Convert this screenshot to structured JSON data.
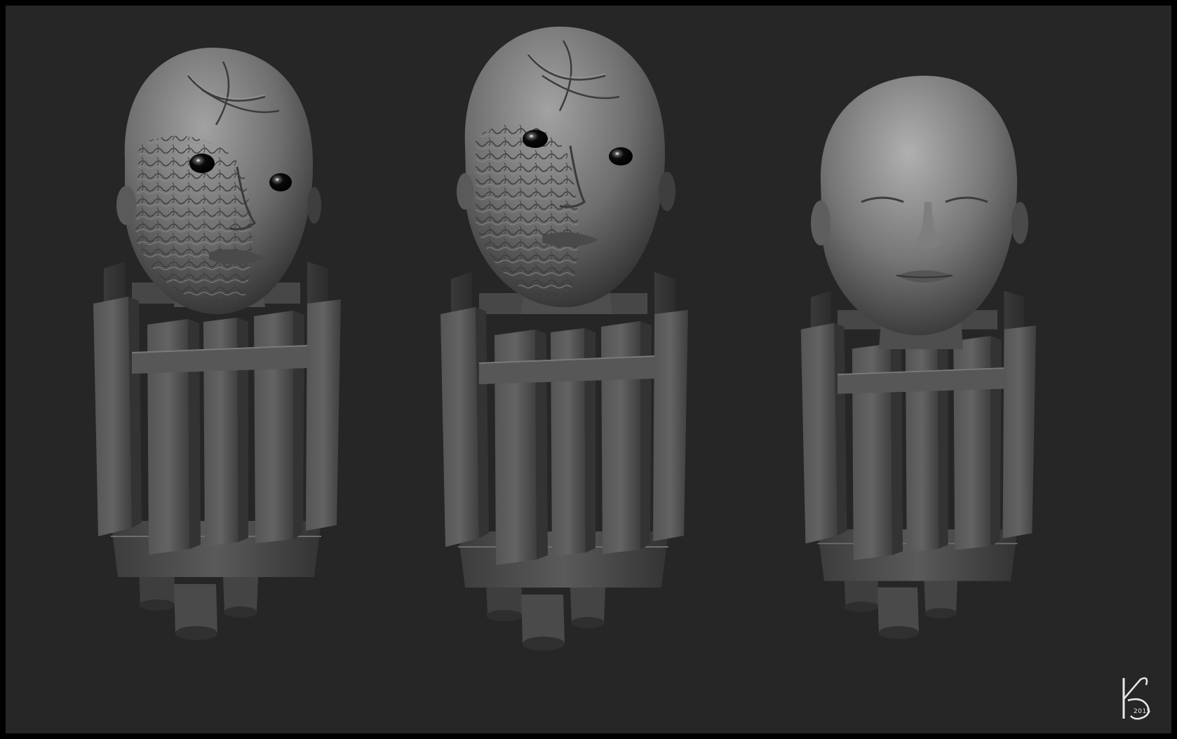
{
  "scene": {
    "background_color": "#262626",
    "frame_color": "#000000",
    "sculpt_base_color": "#6a6a6a",
    "busts": [
      {
        "id": "bust-left",
        "face": "scarred",
        "eyes": "open-black"
      },
      {
        "id": "bust-center",
        "face": "scarred",
        "eyes": "open-black"
      },
      {
        "id": "bust-right",
        "face": "smooth",
        "eyes": "closed"
      }
    ]
  },
  "signature": {
    "monogram_icon": "ks-monogram-icon",
    "year": "2015",
    "color": "#e8e8e8"
  }
}
